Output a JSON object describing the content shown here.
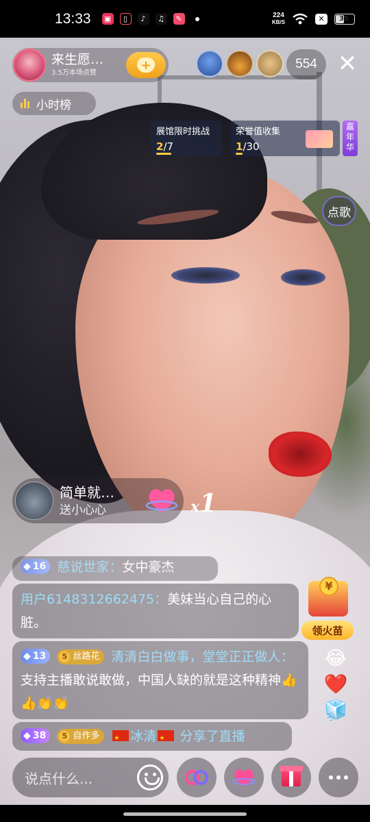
{
  "status_bar": {
    "time": "13:33",
    "net_speed_value": "224",
    "net_speed_unit": "KB/S",
    "battery": "35",
    "icons": [
      "video-app-icon",
      "phone-app-icon",
      "douyin-icon",
      "douyin-lite-icon",
      "notes-app-icon",
      "dot-icon",
      "wifi-icon",
      "close-box-icon",
      "battery-icon"
    ]
  },
  "host": {
    "name": "来生愿…",
    "likes": "3.5万本场点赞",
    "follow_icon": "heart-plus-icon",
    "accent": "#f2a11a"
  },
  "viewers": {
    "count": "554",
    "avatars": [
      "viewer-avatar-1",
      "viewer-avatar-2",
      "viewer-avatar-3"
    ]
  },
  "hourly_rank": {
    "label": "小时榜"
  },
  "challenges": [
    {
      "title": "展馆限时挑战",
      "done": "2",
      "total": "/7",
      "fraction": 0.29
    },
    {
      "title": "荣誉值收集",
      "done": "1",
      "total": "/30",
      "fraction": 0.03
    }
  ],
  "carnival": {
    "label": "嘉年华"
  },
  "song_button": {
    "label": "点歌"
  },
  "gift_notice": {
    "user": "简单就…",
    "action": "送小心心",
    "multiplier_prefix": "x",
    "multiplier": "1",
    "gift_icon": "heart-gift-icon"
  },
  "chat": [
    {
      "level": "16",
      "user": "慈说世家",
      "separator": "：",
      "text": "女中豪杰"
    },
    {
      "user": "用户6148312662475",
      "separator": "：",
      "text": "美妹当心自己的心脏。"
    },
    {
      "level": "13",
      "fan_level": "5",
      "fan_club": "丝路花",
      "user": "清清白白做事，堂堂正正做人",
      "separator": "：",
      "text": "支持主播敢说敢做，中国人缺的就是这种精神👍👍👏👏"
    },
    {
      "level": "38",
      "fan_level": "5",
      "fan_club": "自作多",
      "user": "冰清",
      "text": "分享了直播"
    }
  ],
  "fire_widget": {
    "label": "领火苗",
    "coin_symbol": "¥"
  },
  "side_emojis": [
    "😂",
    "❤️",
    "🧊"
  ],
  "bottom_bar": {
    "input_placeholder": "说点什么...",
    "buttons": [
      "emoji-icon",
      "link-icon",
      "heart-icon",
      "gift-icon",
      "more-icon"
    ]
  }
}
